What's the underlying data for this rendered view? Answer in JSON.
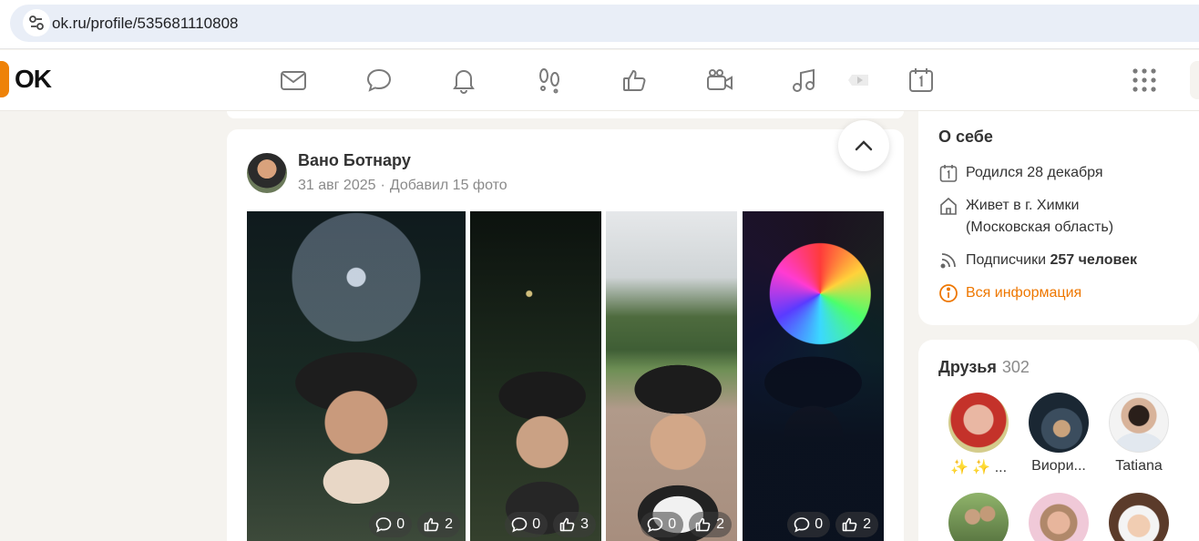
{
  "browser": {
    "url": "ok.ru/profile/535681110808"
  },
  "topnav": {
    "logo": "OK",
    "icons": [
      "mail-icon",
      "chat-icon",
      "bell-icon",
      "guests-icon",
      "like-icon",
      "video-camera-icon",
      "music-icon",
      "play-icon",
      "calendar-icon",
      "apps-grid-icon"
    ]
  },
  "post": {
    "author": "Вано Ботнару",
    "date": "31 авг 2025",
    "separator": "·",
    "action": "Добавил 15 фото",
    "photos": [
      {
        "comments": "0",
        "likes": "2"
      },
      {
        "comments": "0",
        "likes": "3"
      },
      {
        "comments": "0",
        "likes": "2"
      },
      {
        "comments": "0",
        "likes": "2"
      }
    ]
  },
  "about": {
    "title": "О себе",
    "birthday": "Родился 28 декабря",
    "location_line1": "Живет в г. Химки",
    "location_line2": "(Московская область)",
    "subscribers_prefix": "Подписчики",
    "subscribers_value": "257 человек",
    "all_info": "Вся информация"
  },
  "friends": {
    "title": "Друзья",
    "count": "302",
    "items": [
      {
        "name": "✨ ✨ ..."
      },
      {
        "name": "Виори..."
      },
      {
        "name": "Tatiana"
      }
    ]
  },
  "colors": {
    "accent": "#ee8208",
    "link": "#ee7700",
    "page_bg": "#f5f3ef"
  }
}
